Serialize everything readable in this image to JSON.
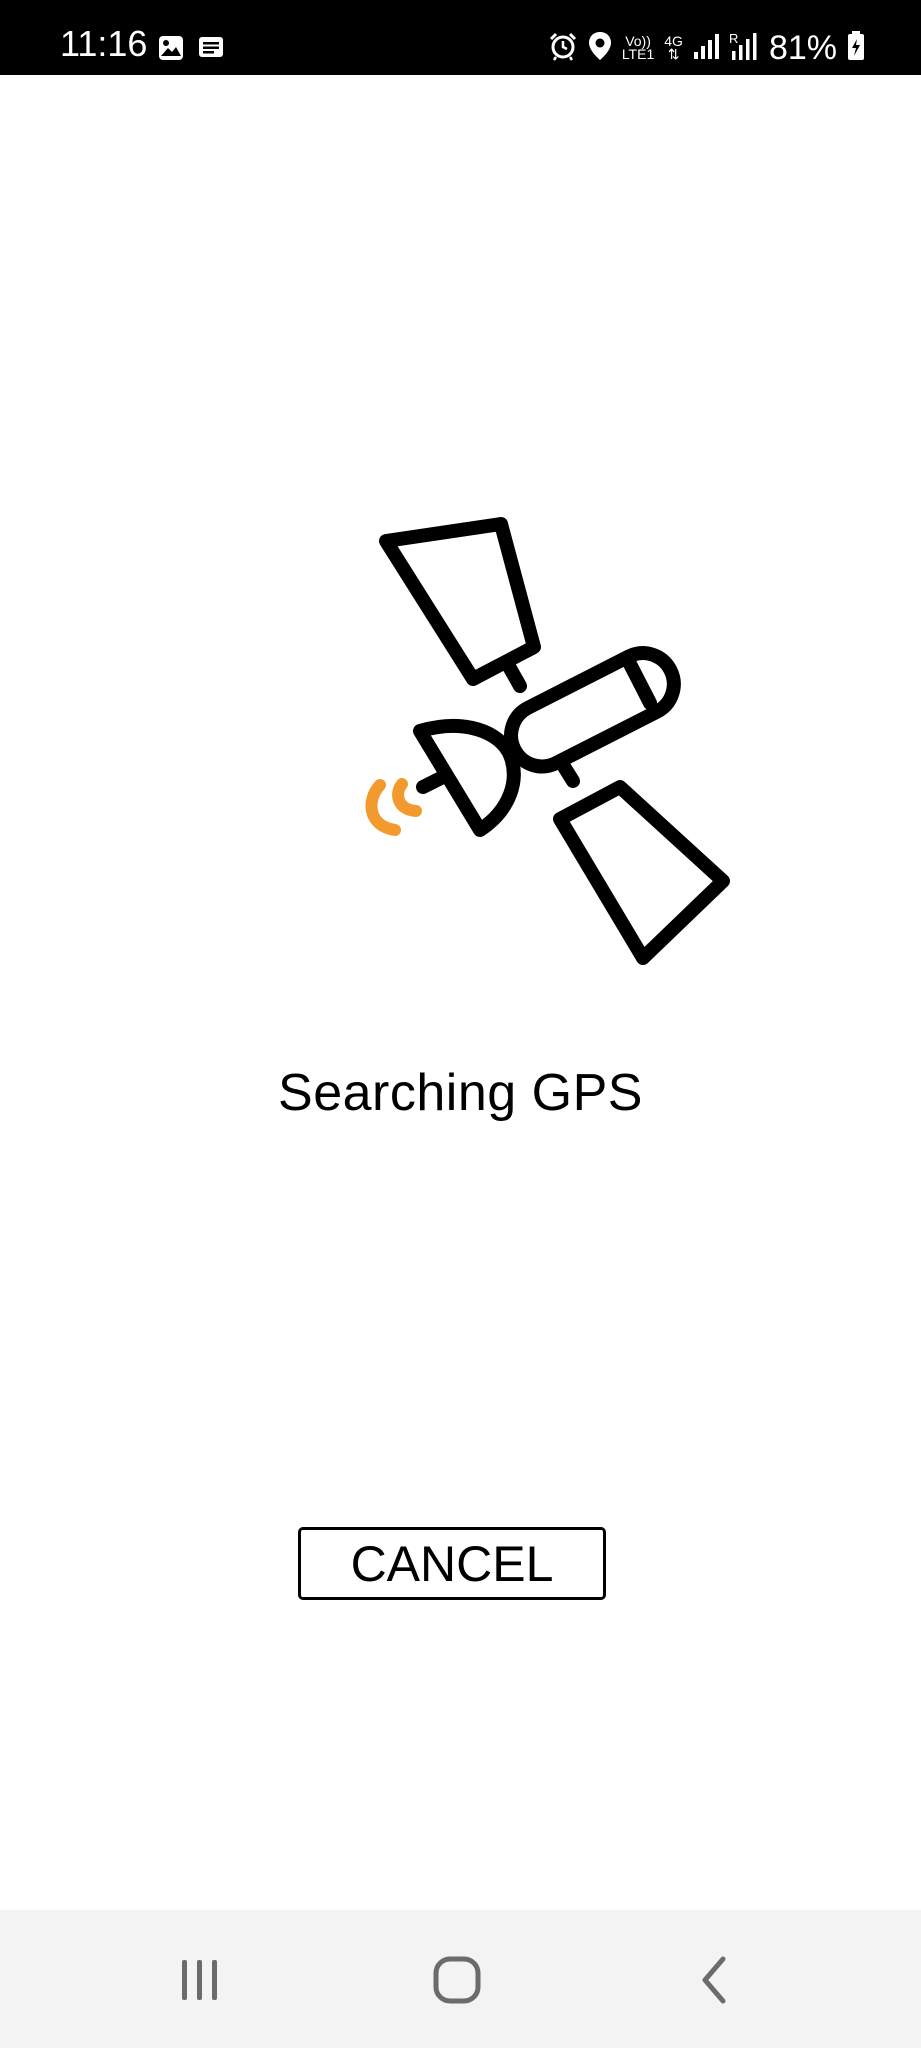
{
  "status_bar": {
    "time": "11:16",
    "network_top": "Vo))",
    "network_bottom": "LTE1",
    "data_type": "4G",
    "battery_percent": "81%",
    "icons": [
      "image-icon",
      "message-icon",
      "alarm-icon",
      "location-icon",
      "volte-icon",
      "data-arrows-icon",
      "signal-icon",
      "roaming-signal-icon",
      "battery-charging-icon"
    ]
  },
  "main": {
    "illustration": "satellite-icon",
    "signal_icon": "signal-waves-icon",
    "status_message": "Searching GPS",
    "cancel_label": "CANCEL"
  },
  "nav_bar": {
    "items": [
      "recent-apps-icon",
      "home-icon",
      "back-icon"
    ]
  },
  "colors": {
    "status_bar_bg": "#000000",
    "accent_signal": "#f39a2e",
    "nav_bar_bg": "#f3f3f3",
    "text": "#000000"
  }
}
